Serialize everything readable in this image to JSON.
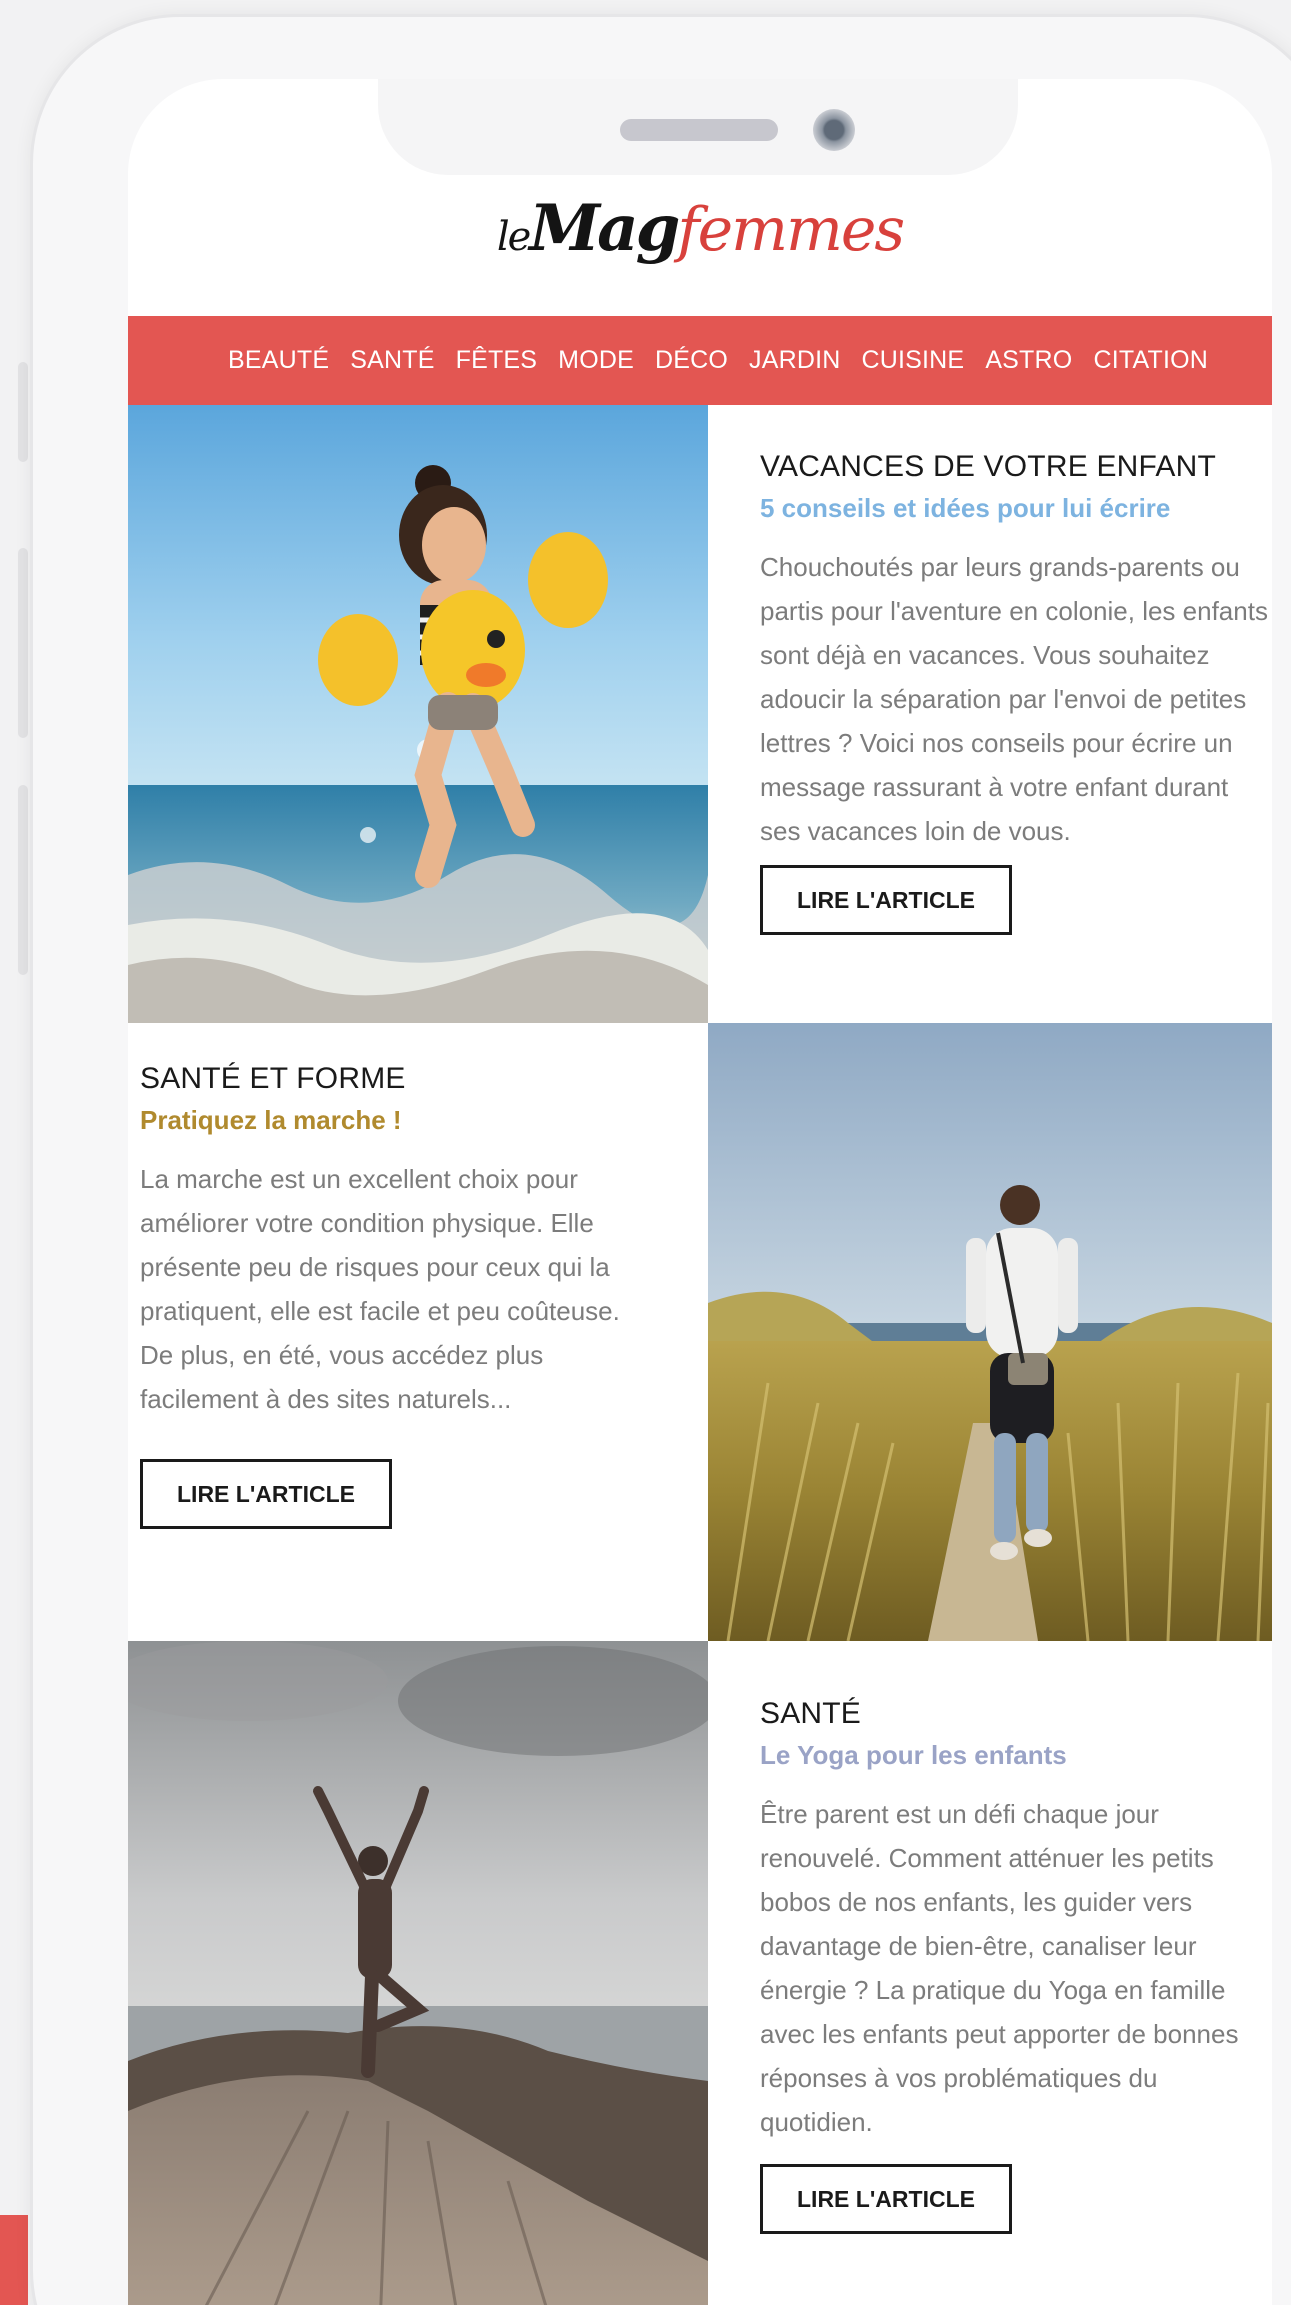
{
  "brand": {
    "logo_le": "le",
    "logo_mag": "Mag",
    "logo_femmes": "femmes",
    "primary_color": "#e35652"
  },
  "nav": {
    "items": [
      "BEAUTÉ",
      "SANTÉ",
      "FÊTES",
      "MODE",
      "DÉCO",
      "JARDIN",
      "CUISINE",
      "ASTRO",
      "CITATION"
    ]
  },
  "articles": [
    {
      "title": "VACANCES DE VOTRE ENFANT",
      "subtitle": "5 conseils et idées pour lui écrire",
      "subtitle_color": "#7db3e0",
      "body": "Chouchoutés par leurs grands-parents ou partis pour l'aventure en colonie, les enfants sont déjà en vacances. Vous souhaitez adoucir la séparation par l'envoi de petites lettres ? Voici nos conseils pour écrire un message rassurant à votre enfant durant ses vacances loin de vous.",
      "button": "LIRE L'ARTICLE",
      "image": "child-beach-photo"
    },
    {
      "title": "SANTÉ ET FORME",
      "subtitle": "Pratiquez la marche !",
      "subtitle_color": "#b08a2e",
      "body": "La marche est un excellent choix pour améliorer votre condition physique. Elle présente peu de risques pour ceux qui la pratiquent, elle est facile et peu coûteuse. De plus, en été, vous accédez plus facilement à des sites naturels...",
      "button": "LIRE L'ARTICLE",
      "image": "woman-walking-photo"
    },
    {
      "title": "SANTÉ",
      "subtitle": "Le Yoga pour les enfants",
      "subtitle_color": "#9aa3c6",
      "body": "Être parent est un défi chaque jour renouvelé. Comment atténuer les petits bobos de nos enfants, les guider vers davantage de bien-être, canaliser leur énergie ? La pratique du Yoga en famille avec les enfants peut apporter de bonnes réponses à vos problématiques du quotidien.",
      "button": "LIRE L'ARTICLE",
      "image": "yoga-rock-photo"
    }
  ]
}
